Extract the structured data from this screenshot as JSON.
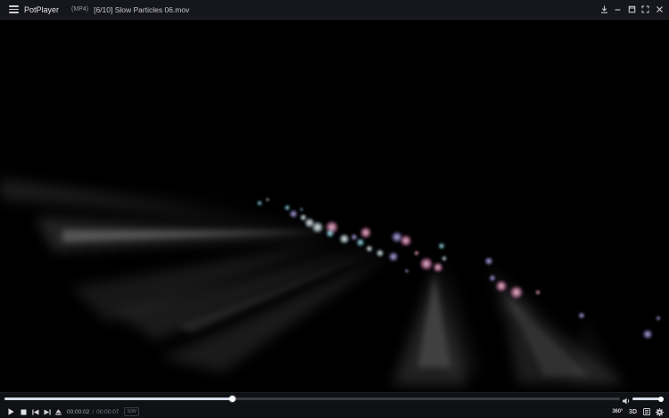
{
  "titlebar": {
    "app_name": "PotPlayer",
    "format": "(MP4)",
    "file_title": "[6/10] Slow Particles 06.mov"
  },
  "playback": {
    "progress": 0.37,
    "volume": 0.9,
    "time_current": "00:00:02",
    "time_separator": "/",
    "time_total": "00:00:07",
    "decoder_badge": "S/W"
  },
  "controls": {
    "btn_360": "360°",
    "btn_3d": "3D"
  },
  "icons": {
    "menu": "hamburger-menu-icon",
    "download": "download-icon",
    "minimize": "minimize-icon",
    "maximize": "maximize-icon",
    "fullscreen": "fullscreen-icon",
    "close": "close-icon",
    "play": "play-icon",
    "stop": "stop-icon",
    "prev": "previous-icon",
    "next": "next-icon",
    "eject": "eject-icon",
    "volume": "volume-icon",
    "playlist": "playlist-icon",
    "settings": "settings-gear-icon"
  },
  "colors": {
    "titlebar_bg": "#16171c",
    "control_bg": "#101115",
    "seek_fill": "#d8dbe8",
    "accent": "#ffffff"
  }
}
